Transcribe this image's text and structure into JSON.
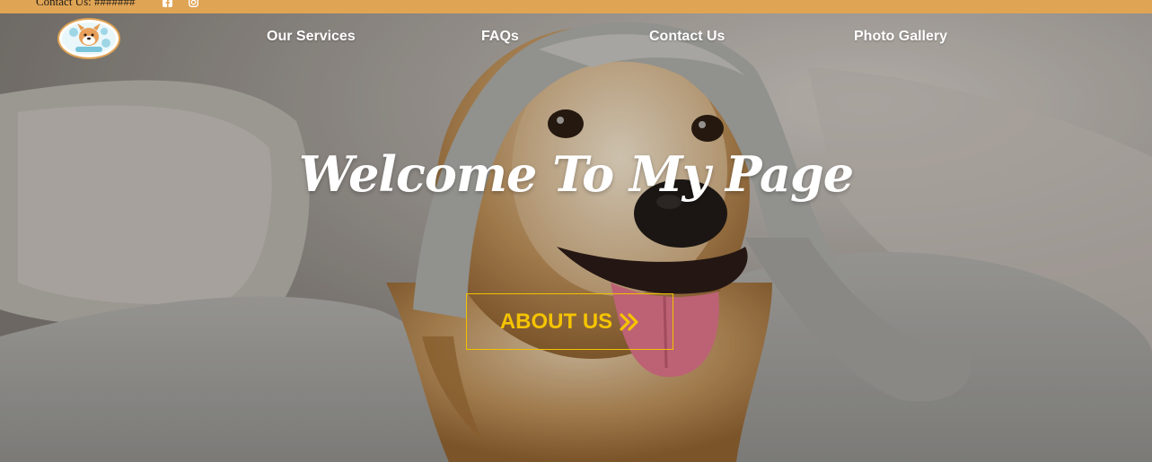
{
  "topbar": {
    "contact_text": "Contact Us: #######",
    "social_icons": [
      "facebook-icon",
      "instagram-icon"
    ]
  },
  "nav": {
    "logo": "dog-logo",
    "items": [
      {
        "label": "Our Services"
      },
      {
        "label": "FAQs"
      },
      {
        "label": "Contact Us"
      },
      {
        "label": "Photo Gallery"
      }
    ]
  },
  "hero": {
    "headline": "Welcome To My Page",
    "button_label": "ABOUT US",
    "button_icon": "double-chevron-right-icon"
  },
  "colors": {
    "topbar": "#e0a455",
    "accent": "#f5c400",
    "nav_text": "#ffffff"
  }
}
